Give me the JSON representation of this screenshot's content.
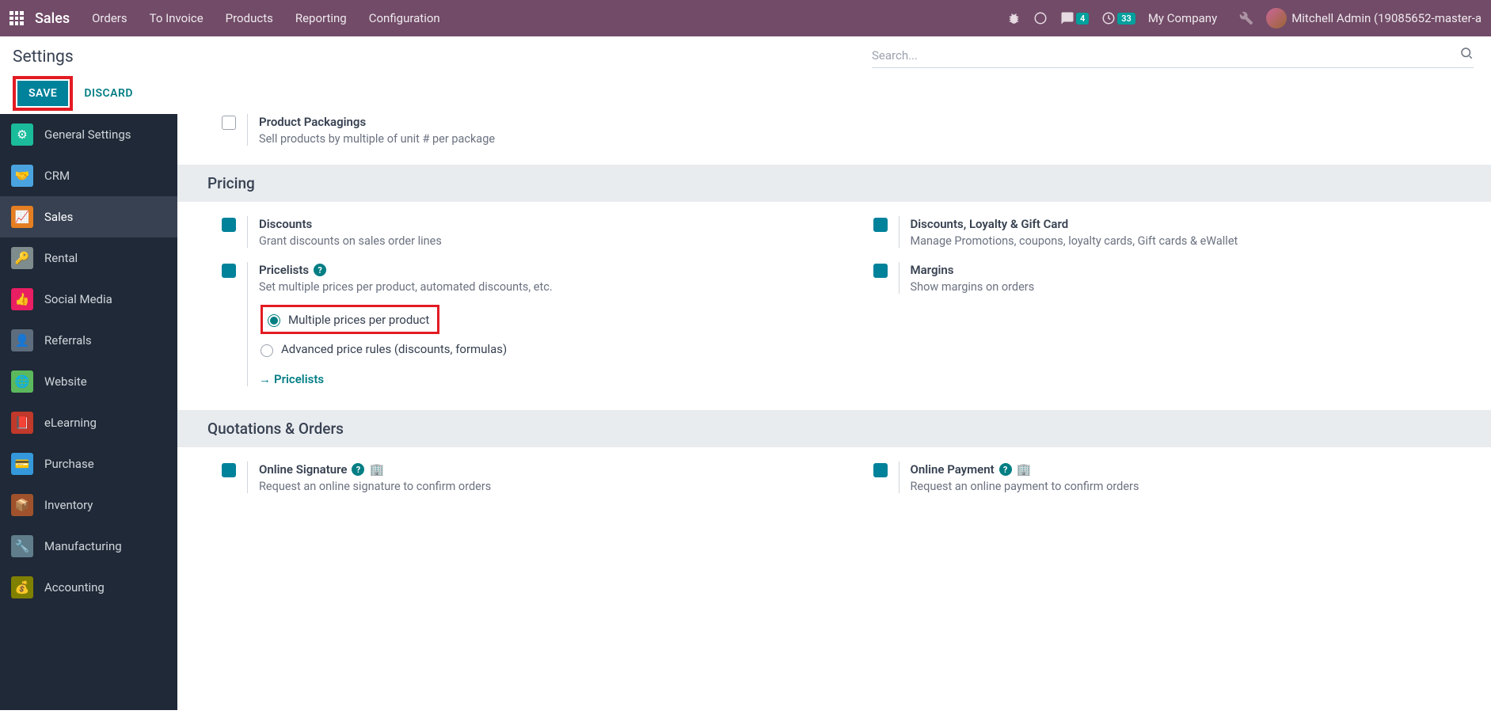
{
  "navbar": {
    "brand": "Sales",
    "menu": [
      "Orders",
      "To Invoice",
      "Products",
      "Reporting",
      "Configuration"
    ],
    "chat_badge": "4",
    "clock_badge": "33",
    "company": "My Company",
    "user": "Mitchell Admin (19085652-master-a"
  },
  "controlPanel": {
    "title": "Settings",
    "search_placeholder": "Search...",
    "save": "SAVE",
    "discard": "DISCARD"
  },
  "sidebar": {
    "items": [
      {
        "label": "General Settings"
      },
      {
        "label": "CRM"
      },
      {
        "label": "Sales"
      },
      {
        "label": "Rental"
      },
      {
        "label": "Social Media"
      },
      {
        "label": "Referrals"
      },
      {
        "label": "Website"
      },
      {
        "label": "eLearning"
      },
      {
        "label": "Purchase"
      },
      {
        "label": "Inventory"
      },
      {
        "label": "Manufacturing"
      },
      {
        "label": "Accounting"
      }
    ]
  },
  "content": {
    "packagings": {
      "title": "Product Packagings",
      "desc": "Sell products by multiple of unit # per package"
    },
    "sections": [
      {
        "header": "Pricing",
        "left": [
          {
            "title": "Discounts",
            "desc": "Grant discounts on sales order lines"
          },
          {
            "title": "Pricelists",
            "desc": "Set multiple prices per product, automated discounts, etc."
          }
        ],
        "right": [
          {
            "title": "Discounts, Loyalty & Gift Card",
            "desc": "Manage Promotions, coupons, loyalty cards, Gift cards & eWallet"
          },
          {
            "title": "Margins",
            "desc": "Show margins on orders"
          }
        ],
        "radios": {
          "opt1": "Multiple prices per product",
          "opt2": "Advanced price rules (discounts, formulas)"
        },
        "link": "Pricelists"
      },
      {
        "header": "Quotations & Orders",
        "left": [
          {
            "title": "Online Signature",
            "desc": "Request an online signature to confirm orders"
          }
        ],
        "right": [
          {
            "title": "Online Payment",
            "desc": "Request an online payment to confirm orders"
          }
        ]
      }
    ]
  }
}
